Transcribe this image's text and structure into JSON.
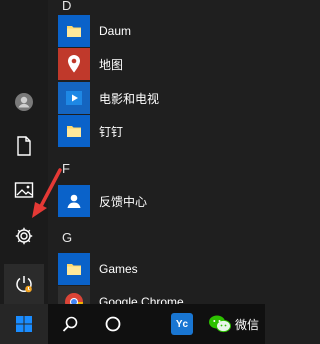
{
  "start_menu": {
    "groups": [
      {
        "letter": "D",
        "apps": [
          {
            "name": "Daum",
            "icon": "folder-icon"
          }
        ]
      },
      {
        "letter": "",
        "apps": [
          {
            "name": "地图",
            "icon": "map-pin-icon"
          },
          {
            "name": "电影和电视",
            "icon": "movies-tv-icon"
          },
          {
            "name": "钉钉",
            "icon": "folder-icon"
          }
        ]
      },
      {
        "letter": "F",
        "apps": [
          {
            "name": "反馈中心",
            "icon": "feedback-hub-icon"
          }
        ]
      },
      {
        "letter": "G",
        "apps": [
          {
            "name": "Games",
            "icon": "folder-icon"
          },
          {
            "name": "Google Chrome",
            "icon": "chrome-icon"
          }
        ]
      }
    ],
    "rail_icons": [
      "account-icon",
      "documents-icon",
      "pictures-icon",
      "settings-icon",
      "power-icon"
    ]
  },
  "taskbar": {
    "items": [
      {
        "icon": "windows-start-icon"
      },
      {
        "icon": "search-icon"
      },
      {
        "icon": "task-view-icon"
      },
      {
        "icon": "yc-app-icon",
        "label": "Yc"
      },
      {
        "icon": "wechat-icon",
        "label": "微信"
      }
    ]
  },
  "colors": {
    "tile": "#0a62c9",
    "annotation_arrow": "#e53935",
    "folder": "#ffd86b"
  }
}
